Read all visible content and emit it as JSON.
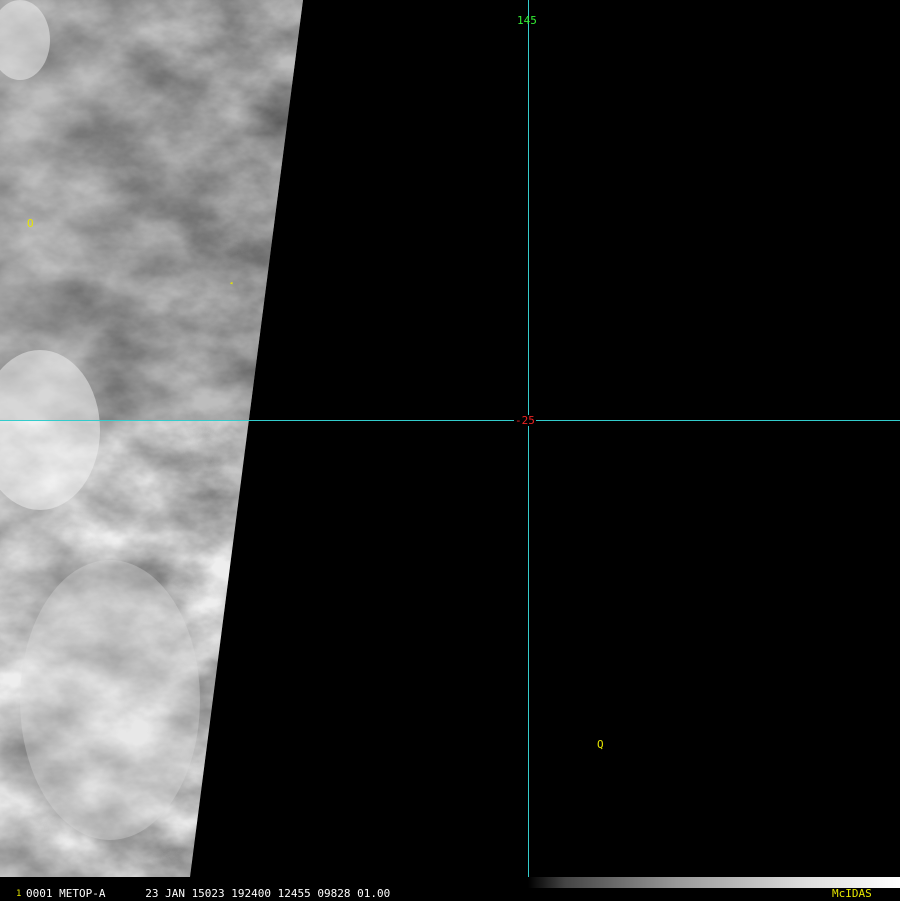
{
  "image": {
    "description_type": "satellite-imagery",
    "colors": {
      "graticule": "#33cccc",
      "longitude_label": "#33ee33",
      "latitude_label": "#ee2222",
      "markers": "#e6e600",
      "status_text": "#ffffff",
      "brand": "#e6e600"
    }
  },
  "graticule": {
    "longitude_label": "145",
    "latitude_label": "-25"
  },
  "markers": {
    "o": "O",
    "q": "Q",
    "tri": "◂"
  },
  "status_bar": {
    "frame_number": "1",
    "line": "0001 METOP-A      23 JAN 15023 192400 12455 09828 01.00",
    "brand": "McIDAS"
  }
}
